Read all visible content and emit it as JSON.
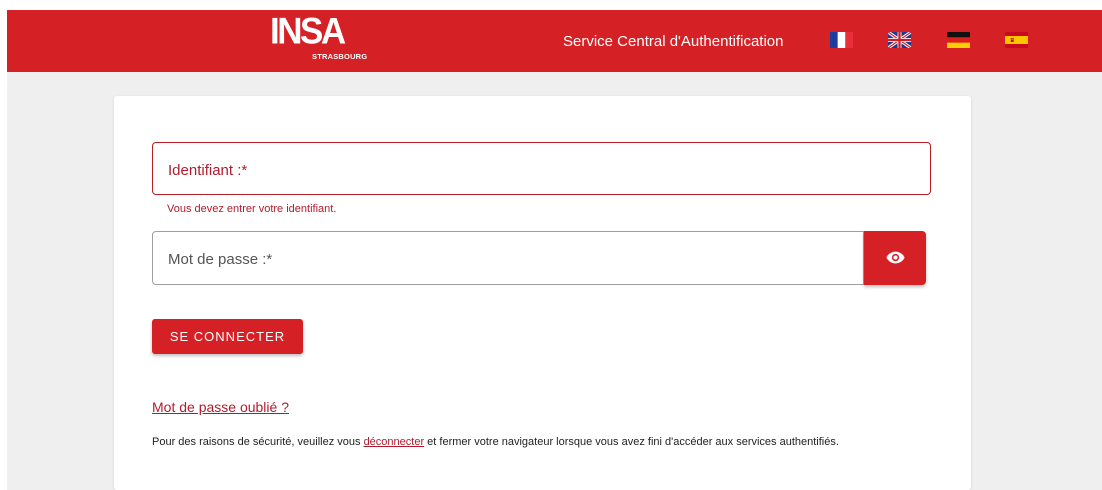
{
  "header": {
    "logo_main": "INSA",
    "logo_sub": "STRASBOURG",
    "service_title": "Service Central d'Authentification",
    "flags": [
      {
        "name": "flag-france-icon",
        "lang": "fr"
      },
      {
        "name": "flag-uk-icon",
        "lang": "en"
      },
      {
        "name": "flag-germany-icon",
        "lang": "de"
      },
      {
        "name": "flag-spain-icon",
        "lang": "es"
      }
    ]
  },
  "form": {
    "identifier_label": "Identifiant :*",
    "identifier_error": "Vous devez entrer votre identifiant.",
    "password_label": "Mot de passe :*",
    "show_password_icon": "eye-icon",
    "submit_label": "SE CONNECTER",
    "forgot_password_label": "Mot de passe oublié ?"
  },
  "security_notice": {
    "before_link": "Pour des raisons de sécurité, veuillez vous ",
    "link_text": "déconnecter",
    "after_link": " et fermer votre navigateur lorsque vous avez fini d'accéder aux services authentifiés."
  },
  "colors": {
    "brand_red": "#d52026",
    "error_red": "#b01c2e",
    "page_background": "#efefef",
    "card_background": "#ffffff"
  }
}
